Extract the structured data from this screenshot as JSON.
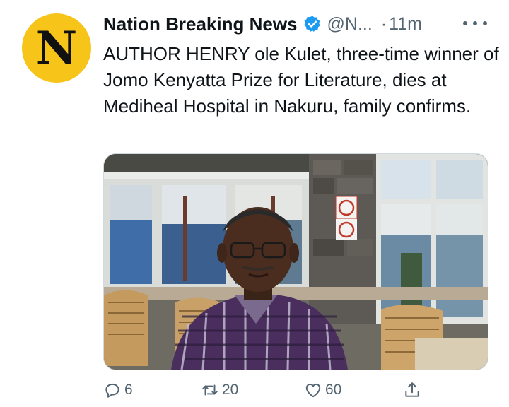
{
  "tweet": {
    "avatar_letter": "N",
    "author_name": "Nation Breaking News",
    "handle": "@N...",
    "separator": "·",
    "time": "11m",
    "text": "AUTHOR HENRY ole Kulet, three-time winner of Jomo Kenyatta Prize for Literature, dies at Mediheal Hospital in Nakuru, family confirms.",
    "actions": {
      "reply_count": "6",
      "retweet_count": "20",
      "like_count": "60"
    }
  },
  "colors": {
    "avatar_bg": "#f7c41a",
    "verified": "#1d9bf0",
    "secondary_text": "#536471"
  },
  "icons": {
    "verified": "verified-badge-icon",
    "more": "more-options-icon",
    "reply": "reply-icon",
    "retweet": "retweet-icon",
    "like": "heart-icon",
    "share": "share-icon"
  }
}
